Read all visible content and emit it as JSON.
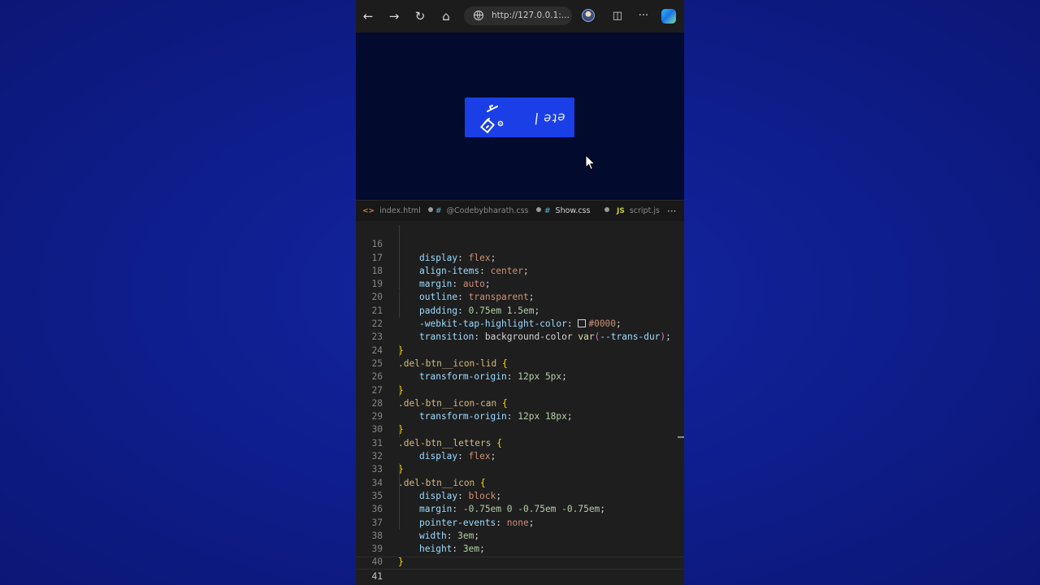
{
  "browser": {
    "url": "http://127.0.0.1:..."
  },
  "preview": {
    "button_letters": "ǀ ǝʇǝ"
  },
  "tabs": [
    {
      "icon": "<>",
      "label": "index.html",
      "icon_color": "#e37933"
    },
    {
      "icon": "#",
      "label": "@Codebybharath.css",
      "icon_color": "#519aba"
    },
    {
      "icon": "#",
      "label": "Show.css",
      "icon_color": "#519aba"
    },
    {
      "icon": "JS",
      "label": "script.js",
      "icon_color": "#cbcb41"
    }
  ],
  "code": {
    "line_numbers": [
      "16",
      "17",
      "18",
      "19",
      "20",
      "21",
      "22",
      "23",
      "24",
      "25",
      "26",
      "27",
      "28",
      "29",
      "30",
      "31",
      "32",
      "33",
      "34",
      "35",
      "36",
      "37",
      "38",
      "39",
      "40",
      "41"
    ],
    "l16": {
      "prop": "display",
      "val": "flex"
    },
    "l17": {
      "prop": "align-items",
      "val": "center"
    },
    "l18": {
      "prop": "margin",
      "val": "auto"
    },
    "l19": {
      "prop": "outline",
      "val": "transparent"
    },
    "l20": {
      "prop": "padding",
      "val": "0.75em 1.5em"
    },
    "l21": {
      "prop": "-webkit-tap-highlight-color",
      "val": "#0000"
    },
    "l22": {
      "prop": "transition",
      "val_a": "background-color ",
      "fn": "var",
      "arg": "--trans-dur"
    },
    "l24": {
      "sel": ".del-btn__icon-lid"
    },
    "l25": {
      "prop": "transform-origin",
      "val": "12px 5px"
    },
    "l27": {
      "sel": ".del-btn__icon-can"
    },
    "l28": {
      "prop": "transform-origin",
      "val": "12px 18px"
    },
    "l30": {
      "sel": ".del-btn__letters"
    },
    "l31": {
      "prop": "display",
      "val": "flex"
    },
    "l33": {
      "sel": ".del-btn__icon"
    },
    "l34": {
      "prop": "display",
      "val": "block"
    },
    "l35": {
      "prop": "margin",
      "val": "-0.75em 0 -0.75em -0.75em"
    },
    "l36": {
      "prop": "pointer-events",
      "val": "none"
    },
    "l37": {
      "prop": "width",
      "val": "3em"
    },
    "l38": {
      "prop": "height",
      "val": "3em"
    }
  }
}
